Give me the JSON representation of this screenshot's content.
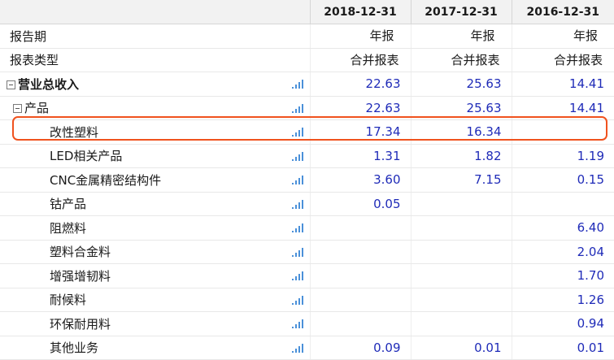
{
  "columns": [
    "2018-12-31",
    "2017-12-31",
    "2016-12-31"
  ],
  "meta_rows": [
    {
      "label": "报告期",
      "values": [
        "年报",
        "年报",
        "年报"
      ]
    },
    {
      "label": "报表类型",
      "values": [
        "合并报表",
        "合并报表",
        "合并报表"
      ]
    }
  ],
  "rows": [
    {
      "label": "营业总收入",
      "level": "total",
      "expandable": true,
      "bold": true,
      "values": [
        "22.63",
        "25.63",
        "14.41"
      ],
      "highlighted": false
    },
    {
      "label": "产品",
      "level": "sub",
      "expandable": true,
      "bold": false,
      "values": [
        "22.63",
        "25.63",
        "14.41"
      ],
      "highlighted": false
    },
    {
      "label": "改性塑料",
      "level": "item",
      "expandable": false,
      "bold": false,
      "values": [
        "17.34",
        "16.34",
        ""
      ],
      "highlighted": true
    },
    {
      "label": "LED相关产品",
      "level": "item",
      "expandable": false,
      "bold": false,
      "values": [
        "1.31",
        "1.82",
        "1.19"
      ],
      "highlighted": false
    },
    {
      "label": "CNC金属精密结构件",
      "level": "item",
      "expandable": false,
      "bold": false,
      "values": [
        "3.60",
        "7.15",
        "0.15"
      ],
      "highlighted": false
    },
    {
      "label": "钴产品",
      "level": "item",
      "expandable": false,
      "bold": false,
      "values": [
        "0.05",
        "",
        ""
      ],
      "highlighted": false
    },
    {
      "label": "阻燃料",
      "level": "item",
      "expandable": false,
      "bold": false,
      "values": [
        "",
        "",
        "6.40"
      ],
      "highlighted": false
    },
    {
      "label": "塑料合金料",
      "level": "item",
      "expandable": false,
      "bold": false,
      "values": [
        "",
        "",
        "2.04"
      ],
      "highlighted": false
    },
    {
      "label": "增强增韧料",
      "level": "item",
      "expandable": false,
      "bold": false,
      "values": [
        "",
        "",
        "1.70"
      ],
      "highlighted": false
    },
    {
      "label": "耐候料",
      "level": "item",
      "expandable": false,
      "bold": false,
      "values": [
        "",
        "",
        "1.26"
      ],
      "highlighted": false
    },
    {
      "label": "环保耐用料",
      "level": "item",
      "expandable": false,
      "bold": false,
      "values": [
        "",
        "",
        "0.94"
      ],
      "highlighted": false
    },
    {
      "label": "其他业务",
      "level": "item",
      "expandable": false,
      "bold": false,
      "values": [
        "0.09",
        "0.01",
        "0.01"
      ],
      "highlighted": false
    }
  ],
  "icons": {
    "row_chart": "bar-chart-icon",
    "toggle": "collapse-minus-icon"
  },
  "colors": {
    "value_text": "#1f2bb8",
    "header_bg": "#f2f2f2",
    "highlight_border": "#f0521e",
    "chart_icon": "#4a90d9"
  }
}
